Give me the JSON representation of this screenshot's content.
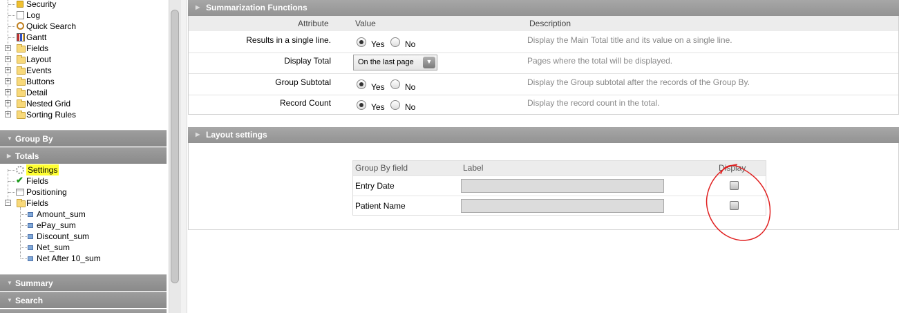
{
  "tree": {
    "top_items": [
      {
        "label": "Security",
        "icon": "lock-icon"
      },
      {
        "label": "Log",
        "icon": "log-icon"
      },
      {
        "label": "Quick Search",
        "icon": "quick-search-icon"
      },
      {
        "label": "Gantt",
        "icon": "gantt-icon"
      }
    ],
    "folders": [
      "Fields",
      "Layout",
      "Events",
      "Buttons",
      "Detail",
      "Nested Grid",
      "Sorting Rules"
    ],
    "sections": {
      "group_by": "Group By",
      "totals": "Totals",
      "summary": "Summary",
      "search": "Search"
    },
    "totals_items": {
      "settings": "Settings",
      "fields": "Fields",
      "positioning": "Positioning",
      "fields_folder": "Fields",
      "field_leaves": [
        "Amount_sum",
        "ePay_sum",
        "Discount_sum",
        "Net_sum",
        "Net After 10_sum"
      ]
    },
    "highlight_color": "#ffff33"
  },
  "summarization": {
    "title": "Summarization Functions",
    "headers": {
      "attribute": "Attribute",
      "value": "Value",
      "description": "Description"
    },
    "rows": [
      {
        "attribute": "Results in a single line.",
        "type": "radio",
        "yes": "Yes",
        "no": "No",
        "selected": "yes",
        "description": "Display the Main Total title and its value on a single line."
      },
      {
        "attribute": "Display Total",
        "type": "select",
        "value": "On the last page",
        "description": "Pages where the total will be displayed."
      },
      {
        "attribute": "Group Subtotal",
        "type": "radio",
        "yes": "Yes",
        "no": "No",
        "selected": "yes",
        "description": "Display the Group subtotal after the records of the Group By."
      },
      {
        "attribute": "Record Count",
        "type": "radio",
        "yes": "Yes",
        "no": "No",
        "selected": "yes",
        "description": "Display the record count in the total."
      }
    ]
  },
  "layout_settings": {
    "title": "Layout settings",
    "headers": {
      "group_by_field": "Group By field",
      "label": "Label",
      "display": "Display"
    },
    "rows": [
      {
        "field": "Entry Date",
        "label": "",
        "display": false
      },
      {
        "field": "Patient Name",
        "label": "",
        "display": false
      }
    ]
  },
  "annotation_color": "#e02020"
}
